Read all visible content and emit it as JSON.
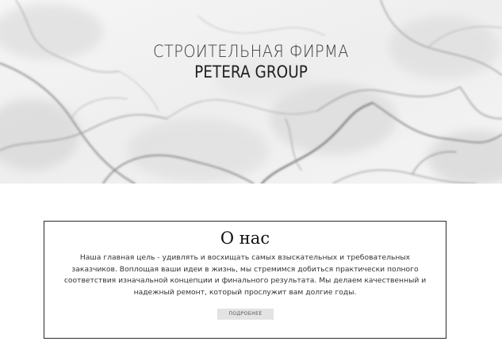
{
  "hero": {
    "line1": "СТРОИТЕЛЬНАЯ ФИРМА",
    "line2": "PETERA GROUP",
    "background": "marble-texture"
  },
  "about": {
    "title": "О нас",
    "text": "Наша главная цель - удивлять и восхищать самых взыскательных и требовательных заказчиков. Воплощая ваши идеи в жизнь, мы стремимся добиться практически полного соответствия изначальной концепции и финального результата. Мы делаем качественный и надежный ремонт, который прослужит вам долгие годы.",
    "button_label": "ПОДРОБНЕЕ"
  },
  "colors": {
    "text_dark": "#1f1f1f",
    "border": "#2a2a2a",
    "button_bg": "#e3e3e3"
  }
}
